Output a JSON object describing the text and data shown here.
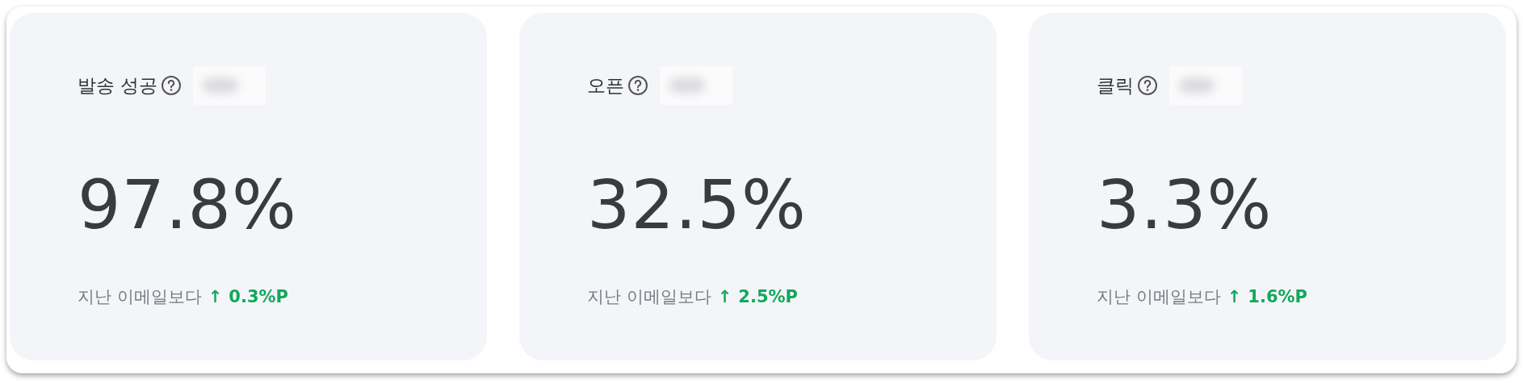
{
  "metrics": [
    {
      "title": "발송 성공",
      "value": "97.8%",
      "comparison": "지난 이메일보다",
      "kind": "increase",
      "arrow": "↑",
      "change": "0.3%P"
    },
    {
      "title": "오픈",
      "value": "32.5%",
      "comparison": "지난 이메일보다",
      "kind": "increase",
      "arrow": "↑",
      "change": "2.5%P"
    },
    {
      "title": "클릭",
      "value": "3.3%",
      "comparison": "지난 이메일보다",
      "kind": "increase",
      "arrow": "↑",
      "change": "1.6%P"
    }
  ]
}
